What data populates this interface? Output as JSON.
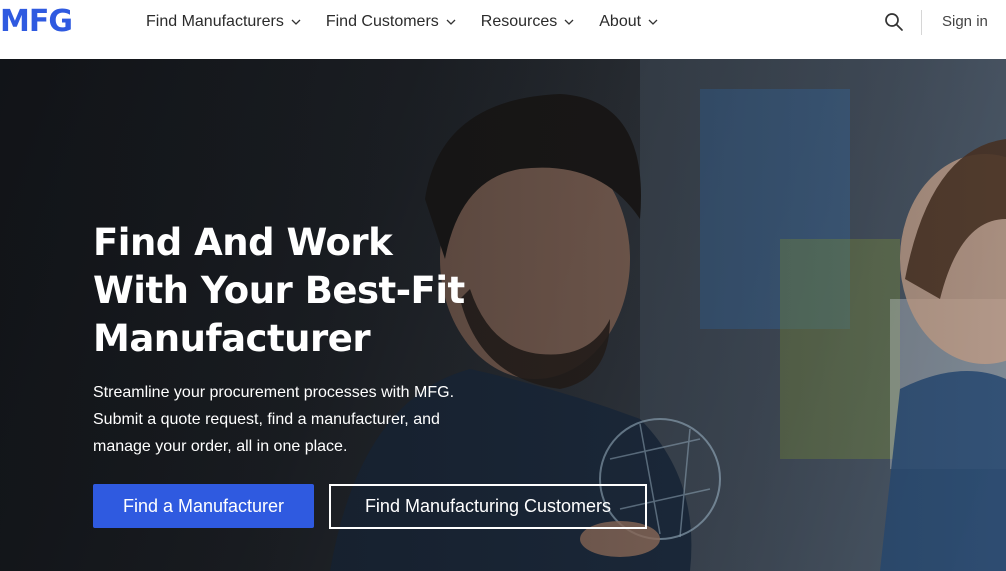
{
  "brand": {
    "logo_text": "MFG",
    "accent": "#2f5ae0"
  },
  "nav": {
    "items": [
      {
        "label": "Find Manufacturers",
        "icon": "chevron-down-icon"
      },
      {
        "label": "Find Customers",
        "icon": "chevron-down-icon"
      },
      {
        "label": "Resources",
        "icon": "chevron-down-icon"
      },
      {
        "label": "About",
        "icon": "chevron-down-icon"
      }
    ],
    "search_icon": "search-icon",
    "signin_label": "Sign in"
  },
  "hero": {
    "title_lines": [
      "Find And Work",
      "With Your Best-Fit",
      "Manufacturer"
    ],
    "subtitle_lines": [
      "Streamline your procurement processes with MFG.",
      "Submit a quote request, find a manufacturer, and",
      "manage your order, all in one place."
    ],
    "primary_button": "Find a Manufacturer",
    "secondary_button": "Find Manufacturing Customers"
  }
}
